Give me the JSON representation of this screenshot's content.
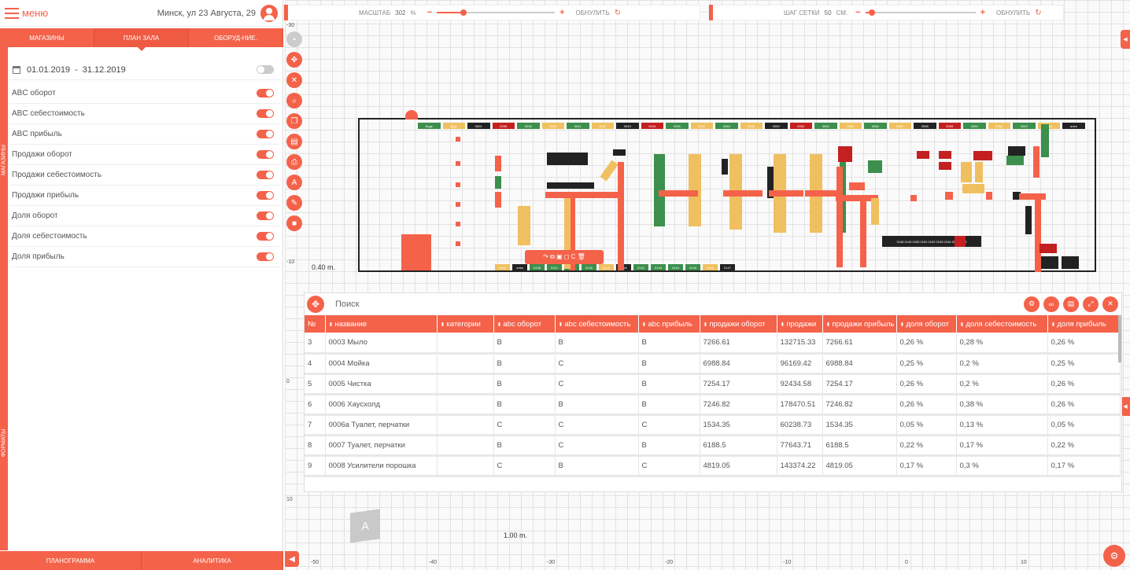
{
  "header": {
    "menu_label": "меню",
    "location": "Минск, ул 23 Августа, 29"
  },
  "tabs": [
    "МАГАЗИНЫ",
    "ПЛАН ЗАЛА",
    "ОБОРУД-НИЕ."
  ],
  "side_strip": [
    "МАГАЗИНЫ",
    "ФОРМАТЫ"
  ],
  "date_range": {
    "from": "01.01.2019",
    "to": "31.12.2019",
    "separator": "-"
  },
  "filters": [
    "ABC оборот",
    "ABC себестоимость",
    "ABC прибыль",
    "Продажи оборот",
    "Продажи себестоимость",
    "Продажи прибыль",
    "Доля оборот",
    "Доля себестоимость",
    "Доля прибыль"
  ],
  "bottom_tabs": [
    "ПЛАНОГРАММА",
    "АНАЛИТИКА"
  ],
  "zoom": {
    "label": "МАСШТАБ",
    "value": "302",
    "unit": "%",
    "reset": "ОБНУЛИТЬ",
    "level": 0.2
  },
  "grid": {
    "label": "ШАГ СЕТКИ",
    "value": "50",
    "unit": "СМ.",
    "reset": "ОБНУЛИТЬ",
    "level": 0.03
  },
  "scales": {
    "plan": "0.40 m.",
    "canvas": "1.00 m."
  },
  "ruler_y": [
    "-30",
    "-10",
    "0",
    "10"
  ],
  "ruler_x": [
    "-50",
    "-40",
    "-30",
    "-20",
    "-10",
    "0",
    "10"
  ],
  "cube_label": "A",
  "panel": {
    "search_placeholder": "Поиск",
    "columns": [
      "№",
      "название",
      "категории",
      "abc оборот",
      "abc себестоимость",
      "abc прибыль",
      "продажи оборот",
      "продажи",
      "продажи прибыль",
      "доля оборот",
      "доля себестоимость",
      "доля прибыль"
    ],
    "rows": [
      [
        "3",
        "0003 Мыло",
        "",
        "B",
        "B",
        "B",
        "7266.61",
        "132715.33",
        "7266.61",
        "0,26 %",
        "0,28 %",
        "0,26 %"
      ],
      [
        "4",
        "0004 Мойка",
        "",
        "B",
        "C",
        "B",
        "6988.84",
        "96169.42",
        "6988.84",
        "0,25 %",
        "0,2 %",
        "0,25 %"
      ],
      [
        "5",
        "0005 Чистка",
        "",
        "B",
        "C",
        "B",
        "7254.17",
        "92434.58",
        "7254.17",
        "0,26 %",
        "0,2 %",
        "0,26 %"
      ],
      [
        "6",
        "0006 Хаусхолд",
        "",
        "B",
        "B",
        "B",
        "7246.82",
        "178470.51",
        "7246.82",
        "0,26 %",
        "0,38 %",
        "0,26 %"
      ],
      [
        "7",
        "0006a Туалет, перчатки",
        "",
        "C",
        "C",
        "C",
        "1534.35",
        "60238.73",
        "1534.35",
        "0,05 %",
        "0,13 %",
        "0,05 %"
      ],
      [
        "8",
        "0007 Туалет, перчатки",
        "",
        "B",
        "C",
        "B",
        "6188.5",
        "77643.71",
        "6188.5",
        "0,22 %",
        "0,17 %",
        "0,22 %"
      ],
      [
        "9",
        "0008 Усилители порошка",
        "",
        "C",
        "B",
        "C",
        "4819.05",
        "143374.22",
        "4819.05",
        "0,17 %",
        "0,3 %",
        "0,17 %"
      ]
    ]
  },
  "plan_labels": {
    "top_row": [
      "Водк",
      "Друг",
      "0001",
      "0036",
      "0038",
      "0040",
      "0041",
      "0042",
      "0043",
      "0044",
      "0046",
      "0047",
      "0048",
      "0049",
      "0050",
      "0062",
      "0063",
      "0064",
      "0066",
      "0067",
      "0068",
      "0069",
      "0060",
      "0062",
      "0063",
      "0065",
      "алек"
    ],
    "bottom_row": [
      "0003",
      "алек",
      "0136",
      "0137",
      "0138",
      "0139",
      "0140",
      "0141",
      "0142",
      "0143",
      "0144",
      "0145",
      "0146",
      "0147"
    ],
    "cluster": [
      "0148",
      "0149",
      "0150",
      "0151",
      "0152",
      "0153",
      "0154",
      "0155",
      "0156"
    ],
    "others": [
      "0134",
      "0011",
      "0012",
      "0013",
      "0014",
      "0015",
      "0160",
      "0161",
      "0168",
      "0169",
      "0170",
      "0173",
      "0175",
      "0164",
      "0186"
    ]
  },
  "colors": {
    "accent": "#f4624a",
    "green": "#3c8f4c",
    "yellow": "#f0c060",
    "dark": "#222222",
    "red": "#c42020"
  }
}
